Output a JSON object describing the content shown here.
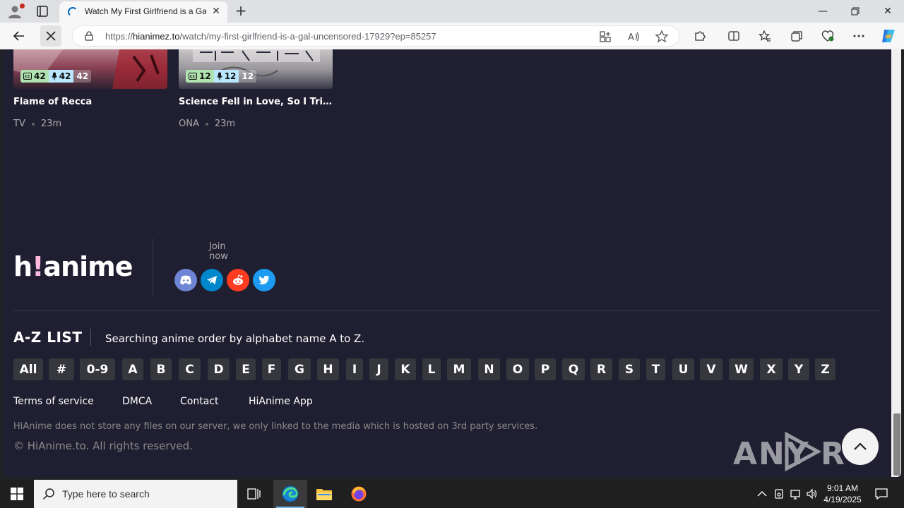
{
  "browser": {
    "tab_title": "Watch My First Girlfriend is a Gal",
    "url_scheme": "https://",
    "url_host": "hianimez.to",
    "url_path": "/watch/my-first-girlfriend-is-a-gal-uncensored-17929?ep=85257"
  },
  "cards": [
    {
      "title": "Flame of Recca",
      "sub": "42",
      "dub": "42",
      "eps": "42",
      "type": "TV",
      "duration": "23m"
    },
    {
      "title": "Science Fell in Love, So I Tried...",
      "sub": "12",
      "dub": "12",
      "eps": "12",
      "type": "ONA",
      "duration": "23m"
    }
  ],
  "footer": {
    "logo_pre": "h",
    "logo_bang": "!",
    "logo_post": "anime",
    "join_line1": "Join",
    "join_line2": "now",
    "az_title": "A-Z LIST",
    "az_description": "Searching anime order by alphabet name A to Z.",
    "letters": [
      "All",
      "#",
      "0-9",
      "A",
      "B",
      "C",
      "D",
      "E",
      "F",
      "G",
      "H",
      "I",
      "J",
      "K",
      "L",
      "M",
      "N",
      "O",
      "P",
      "Q",
      "R",
      "S",
      "T",
      "U",
      "V",
      "W",
      "X",
      "Y",
      "Z"
    ],
    "links": [
      "Terms of service",
      "DMCA",
      "Contact",
      "HiAnime App"
    ],
    "disclaimer": "HiAnime does not store any files on our server, we only linked to the media which is hosted on 3rd party services.",
    "copyright": "© HiAnime.to. All rights reserved."
  },
  "taskbar": {
    "search_placeholder": "Type here to search",
    "time": "9:01 AM",
    "date": "4/19/2025"
  },
  "colors": {
    "page_bg": "#201f31",
    "accent_pink": "#ffbade",
    "sub_badge": "#b0e3af",
    "dub_badge": "#b9e7ff"
  }
}
